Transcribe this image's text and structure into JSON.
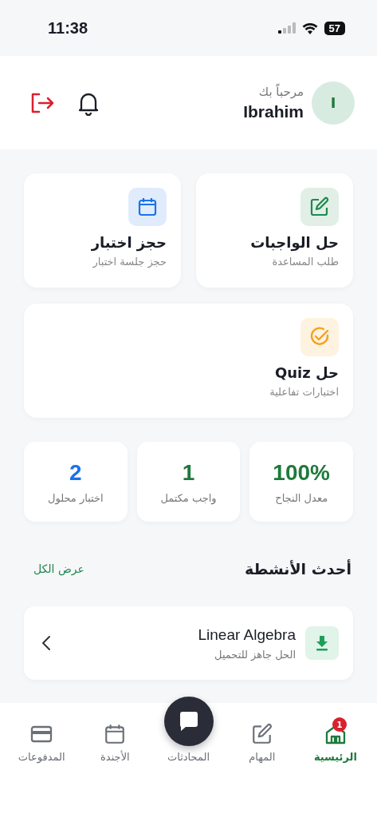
{
  "status_bar": {
    "time": "11:38",
    "battery": "57"
  },
  "header": {
    "avatar": "I",
    "greeting": "مرحباً بك",
    "name": "Ibrahim"
  },
  "actions": [
    {
      "kind": "edit",
      "color": "#1e8a4c",
      "title": "حل الواجبات",
      "subtitle": "طلب المساعدة"
    },
    {
      "kind": "calendar",
      "color": "#1a73e8",
      "title": "حجز اختبار",
      "subtitle": "حجز جلسة اختبار"
    },
    {
      "kind": "check",
      "color": "#f5a01a",
      "title": "حل Quiz",
      "subtitle": "اختبارات تفاعلية"
    }
  ],
  "stats": [
    {
      "value": "100%",
      "label": "معدل النجاح",
      "color": "#1e7a3c"
    },
    {
      "value": "1",
      "label": "واجب مكتمل",
      "color": "#1e7a3c"
    },
    {
      "value": "2",
      "label": "اختبار محلول",
      "color": "#1a73e8"
    }
  ],
  "activity": {
    "title": "أحدث الأنشطة",
    "view_all": "عرض الكل",
    "items": [
      {
        "title": "Linear Algebra",
        "subtitle": "الحل جاهز للتحميل"
      }
    ]
  },
  "nav": [
    {
      "kind": "home",
      "label": "الرئيسية",
      "selected": true,
      "badge": "1"
    },
    {
      "kind": "edit",
      "label": "المهام",
      "selected": false
    },
    {
      "kind": "chat",
      "label": "المحادثات",
      "selected": false
    },
    {
      "kind": "calendar",
      "label": "الأجندة",
      "selected": false
    },
    {
      "kind": "card",
      "label": "المدفوعات",
      "selected": false
    }
  ]
}
